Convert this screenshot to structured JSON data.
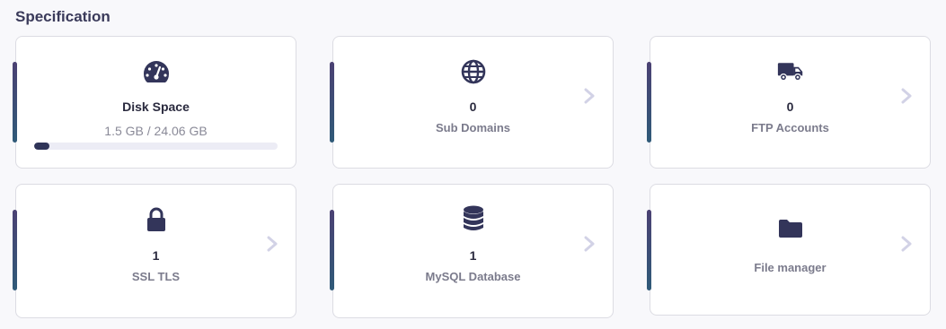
{
  "section_title": "Specification",
  "accent_gradient": [
    "#4b4173",
    "#2f5a78"
  ],
  "icon_color": "#33355a",
  "chevron_color": "#d2d2e6",
  "cards": {
    "disk": {
      "icon": "speedometer-icon",
      "title": "Disk Space",
      "usage": "1.5 GB / 24.06 GB",
      "progress_fraction": 0.0623
    },
    "subdomains": {
      "icon": "globe-icon",
      "value": "0",
      "label": "Sub Domains"
    },
    "ftp": {
      "icon": "truck-icon",
      "value": "0",
      "label": "FTP Accounts"
    },
    "ssl": {
      "icon": "lock-icon",
      "value": "1",
      "label": "SSL TLS"
    },
    "mysql": {
      "icon": "database-icon",
      "value": "1",
      "label": "MySQL Database"
    },
    "files": {
      "icon": "folder-icon",
      "label": "File manager"
    }
  }
}
